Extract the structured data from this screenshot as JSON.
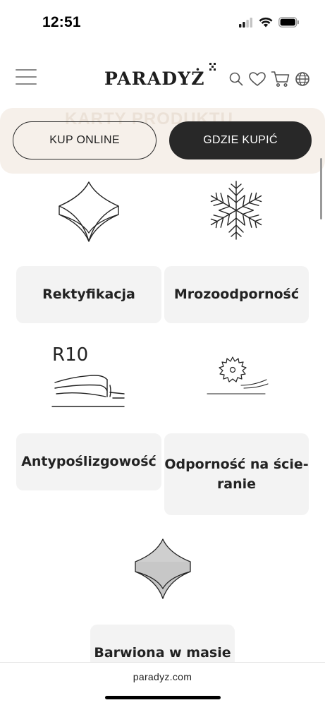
{
  "status_bar": {
    "time": "12:51"
  },
  "header": {
    "logo_text": "PARADYŻ"
  },
  "cta": {
    "ghost_text": "KARTY PRODUKTU",
    "buy_online": "KUP ONLINE",
    "where_to_buy": "GDZIE KUPIĆ"
  },
  "features": {
    "rectification": "Rektyfikacja",
    "frost": "Mrozoodporność",
    "slip_badge": "R10",
    "slip": "Antypoślizgowość",
    "abrasion_1": "Odporność na ście-",
    "abrasion_2": "ranie",
    "through_body": "Barwiona w masie"
  },
  "browser": {
    "url": "paradyz.com"
  },
  "colors": {
    "banner_bg": "#f6f0ea",
    "dark_button": "#282828",
    "card_bg": "#f3f3f3",
    "swatch_fill": "#cfcfcf"
  }
}
